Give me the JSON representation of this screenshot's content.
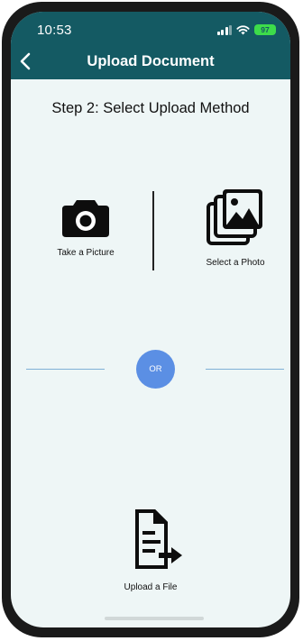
{
  "status_bar": {
    "time": "10:53",
    "battery": "97"
  },
  "header": {
    "title": "Upload Document",
    "back_icon": "chevron-left-icon",
    "background_color": "#145a63"
  },
  "step_title": "Step 2: Select Upload Method",
  "options": {
    "take_picture": {
      "label": "Take a Picture",
      "icon": "camera-icon"
    },
    "select_photo": {
      "label": "Select a Photo",
      "icon": "photo-stack-icon"
    },
    "upload_file": {
      "label": "Upload a File",
      "icon": "file-upload-icon"
    }
  },
  "separator": {
    "label": "OR",
    "color": "#5b8fe4"
  }
}
